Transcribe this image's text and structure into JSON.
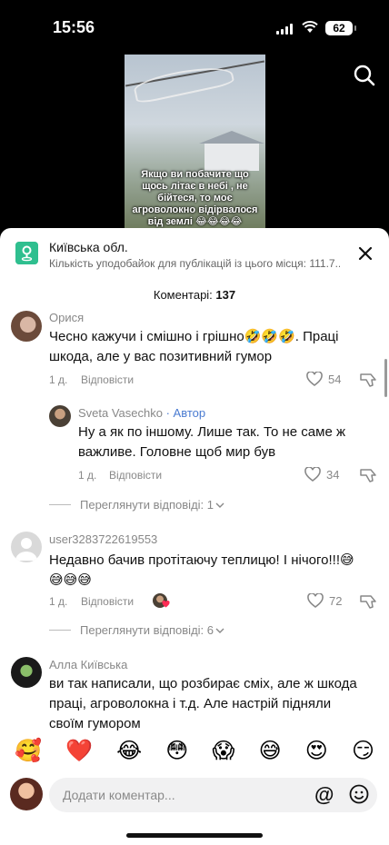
{
  "status_bar": {
    "time": "15:56",
    "battery": "62"
  },
  "video": {
    "caption": "Якщо ви побачите що щось літає в небі , не бійтеся, то моє агроволокно відірвалося від землі 😂😂😂😂"
  },
  "location": {
    "title": "Київська обл.",
    "subtitle": "Кількість уподобайок для публікацій із цього місця: 111.7..."
  },
  "comments_header": {
    "label": "Коментарі:",
    "count": "137"
  },
  "comments": [
    {
      "user": "Орися",
      "text": "Чесно кажучи і смішно і грішно🤣🤣🤣. Праці шкода, але у вас позитивний гумор",
      "age": "1 д.",
      "reply": "Відповісти",
      "likes": "54"
    },
    {
      "user": "Sveta Vasechko",
      "badge": "· Автор",
      "text": "Ну а як по іншому. Лише так. То не саме ж важливе. Головне щоб мир був",
      "age": "1 д.",
      "reply": "Відповісти",
      "likes": "34"
    },
    {
      "user": "user3283722619553",
      "text": "Недавно бачив протітаючу теплицю! І нічого!!!😅😅😅😅",
      "age": "1 д.",
      "reply": "Відповісти",
      "likes": "72"
    },
    {
      "user": "Алла Київська",
      "text": "ви так написали, що розбирає сміх, але ж шкода праці, агроволокна і т.д. Але настрій підняли своїм гумором"
    }
  ],
  "view_replies": [
    {
      "label": "Переглянути відповіді: 1"
    },
    {
      "label": "Переглянути відповіді: 6"
    }
  ],
  "quick_emojis": [
    "🥰",
    "❤️",
    "😂",
    "😳",
    "😱",
    "😅",
    "😍",
    "😏"
  ],
  "input": {
    "placeholder": "Додати коментар...",
    "mention": "@"
  },
  "colors": {
    "accent": "#2fbf8f",
    "author": "#4a7bd1",
    "muted": "#888888"
  }
}
